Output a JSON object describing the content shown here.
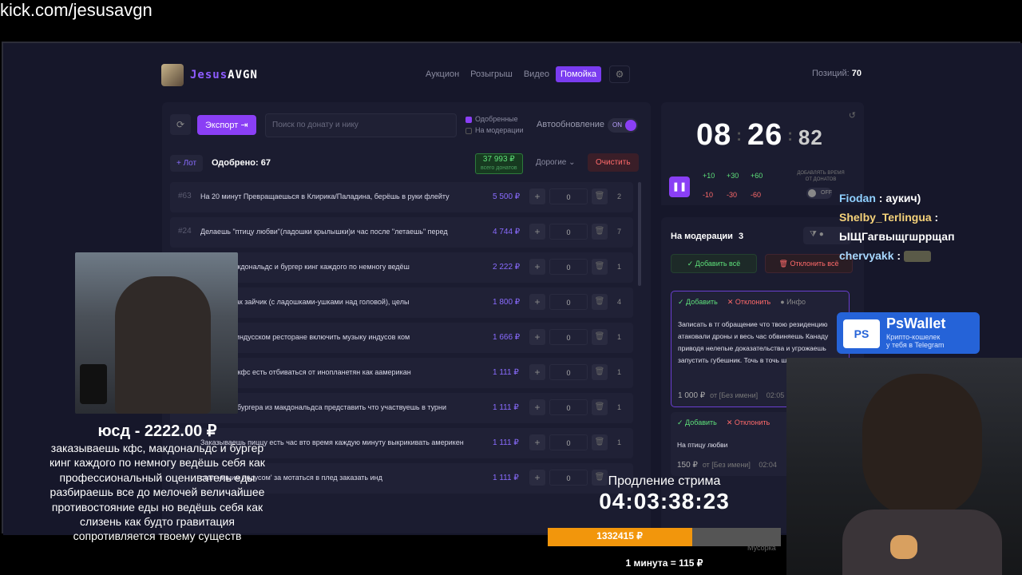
{
  "url": "kick.com/jesusavgn",
  "logo": {
    "part1": "Jesus",
    "part2": "AVGN"
  },
  "nav": {
    "tabs": [
      "Аукцион",
      "Розыгрыш",
      "Видео",
      "Помойка"
    ],
    "active": "Помойка"
  },
  "positions": {
    "label": "Позиций:",
    "value": "70"
  },
  "toolbar": {
    "export_label": "Экспорт",
    "search_placeholder": "Поиск по донату и нику",
    "filter_approved": "Одобренные",
    "filter_moderation": "На модерации",
    "autoupdate_label": "Автообновление",
    "toggle_state": "ON"
  },
  "summary": {
    "lot_button": "+ Лот",
    "approved": "Одобрено: 67",
    "total": "37 993 ₽",
    "total_sub": "всего донатов",
    "sort": "Дорогие",
    "clear": "Очистить"
  },
  "lots": [
    {
      "num": "#63",
      "text": "На 20 минут Превращаешься в Клирика/Паладина, берёшь в руки флейту",
      "price": "5 500 ₽",
      "input": "0",
      "count": "2"
    },
    {
      "num": "#24",
      "text": "Делаешь \"птицу любви\"(ладошки крылышки)и час после \"летаешь\" перед",
      "price": "4 744 ₽",
      "input": "0",
      "count": "7"
    },
    {
      "num": "",
      "text": "шь кфс, макдональдс и бургер кинг каждого по немногу ведёш",
      "price": "2 222 ₽",
      "input": "0",
      "count": "1"
    },
    {
      "num": "",
      "text": "на месте как зайчик (с ладошками-ушками над головой), целы",
      "price": "1 800 ₽",
      "input": "0",
      "count": "4"
    },
    {
      "num": "",
      "text": "позиции в индусском ресторане включить музыку индусов ком",
      "price": "1 666 ₽",
      "input": "0",
      "count": "1"
    },
    {
      "num": "",
      "text": "бургера из кфс есть отбиваться от инопланетян как аамерикан",
      "price": "1 111 ₽",
      "input": "0",
      "count": "1"
    },
    {
      "num": "#4",
      "text": "заказать 4 бургера из макдональдса представить что участвуешь в турни",
      "price": "1 111 ₽",
      "input": "0",
      "count": "1"
    },
    {
      "num": "",
      "text": "Заказываешь пиццу есть час вто время каждую минуту выкрикивать америкен",
      "price": "1 111 ₽",
      "input": "0",
      "count": "1"
    },
    {
      "num": "",
      "text": "стал нищим индусом' за мотаться в плед заказать инд",
      "price": "1 111 ₽",
      "input": "0",
      "count": ""
    }
  ],
  "timer": {
    "hours": "08",
    "minutes": "26",
    "ms": "82",
    "add_plus": [
      "+10",
      "+30",
      "+60"
    ],
    "add_minus": [
      "-10",
      "-30",
      "-60"
    ],
    "donation_time": "ДОБАВЛЯТЬ ВРЕМЯ ОТ ДОНАТОВ",
    "off": "OFF"
  },
  "moderation": {
    "title": "На модерации",
    "count": "3",
    "add_all": "Добавить всё",
    "reject_all": "Отклонить всё",
    "cards": [
      {
        "add": "Добавить",
        "reject": "Отклонить",
        "info": "Инфо",
        "text": "Записать в тг обращение что твою резиденцию атаковали дроны и весь час обвиняешь Канаду приводя нелепые доказательства и угрожаешь запустить губешник. Точь в точь шиз",
        "price": "1 000 ₽",
        "author": "от [Без имени]",
        "time": "02:05"
      },
      {
        "add": "Добавить",
        "reject": "Отклонить",
        "text": "На птицу любви",
        "price": "150 ₽",
        "author": "от [Без имени]",
        "time": "02:04"
      }
    ],
    "trash_label": "Мусорка"
  },
  "donation_alert": {
    "header": "юсд - 2222.00 ₽",
    "message": "заказываешь кфс, макдональдс и бургер кинг каждого по немногу ведёшь себя как профессиональный оцениватель еды разбираешь все до мелочей величайшее противостояние еды но ведёшь себя как слизень как будто гравитация сопротивляется твоему существ"
  },
  "chat": [
    {
      "user": "Fiodan",
      "text": "аукич)"
    },
    {
      "user": "Shelby_Terlingua",
      "text": "ЫЩГагвыщгшррщап"
    },
    {
      "user": "chervyakk",
      "text": ""
    }
  ],
  "pswallet": {
    "badge": "PS",
    "title": "PsWallet",
    "sub1": "Крипто-кошелек",
    "sub2": "у тебя в Telegram"
  },
  "extension": {
    "label": "Продление стрима",
    "time": "04:03:38:23",
    "amount": "1332415 ₽",
    "progress": 0.62,
    "rate": "1 минута = 115 ₽"
  }
}
